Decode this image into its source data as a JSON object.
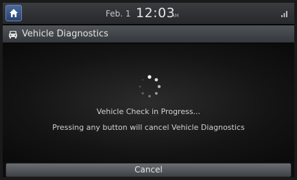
{
  "status_bar": {
    "date": "Feb.  1",
    "time": "12:03",
    "ampm": "AM",
    "home_icon": "home-icon",
    "signal_icon": "signal-icon"
  },
  "title_bar": {
    "title": "Vehicle Diagnostics",
    "icon": "car-icon"
  },
  "content": {
    "progress_text": "Vehicle Check in Progress...",
    "hint_text": "Pressing any button will cancel Vehicle Diagnostics"
  },
  "cancel_button": {
    "label": "Cancel"
  },
  "colors": {
    "home_button": "#3a5a8a",
    "background": "#0d0d0d",
    "text": "#d2d2d2"
  }
}
